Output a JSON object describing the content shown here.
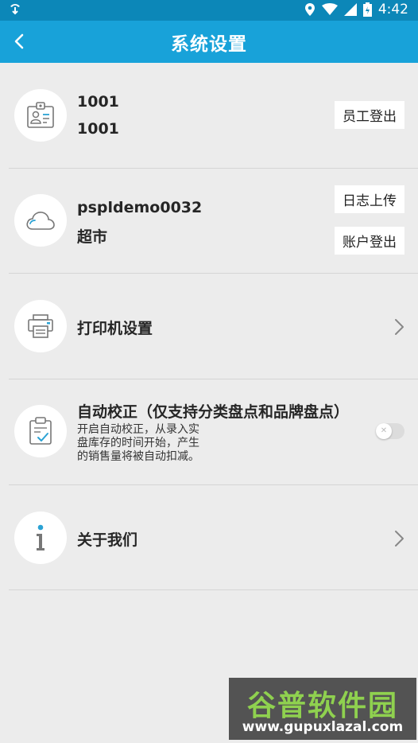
{
  "status_bar": {
    "time": "4:42"
  },
  "header": {
    "title": "系统设置"
  },
  "rows": {
    "employee": {
      "line1": "1001",
      "line2": "1001",
      "button": "员工登出"
    },
    "account": {
      "line1": "pspldemo0032",
      "line2": "超市",
      "upload_button": "日志上传",
      "logout_button": "账户登出"
    },
    "printer": {
      "label": "打印机设置"
    },
    "autocorrect": {
      "label": "自动校正（仅支持分类盘点和品牌盘点）",
      "desc_lines": [
        "开启自动校正，从录入实",
        "盘库存的时间开始，产生",
        "的销售量将被自动扣减。"
      ],
      "enabled": false
    },
    "about": {
      "label": "关于我们"
    }
  },
  "watermark": {
    "title": "谷普软件园",
    "url": "www.gupuxlazal.com"
  },
  "colors": {
    "status_bar": "#0c87b8",
    "app_bar": "#18a2d9",
    "background": "#ececec",
    "icon_blue": "#2aa2d4"
  }
}
